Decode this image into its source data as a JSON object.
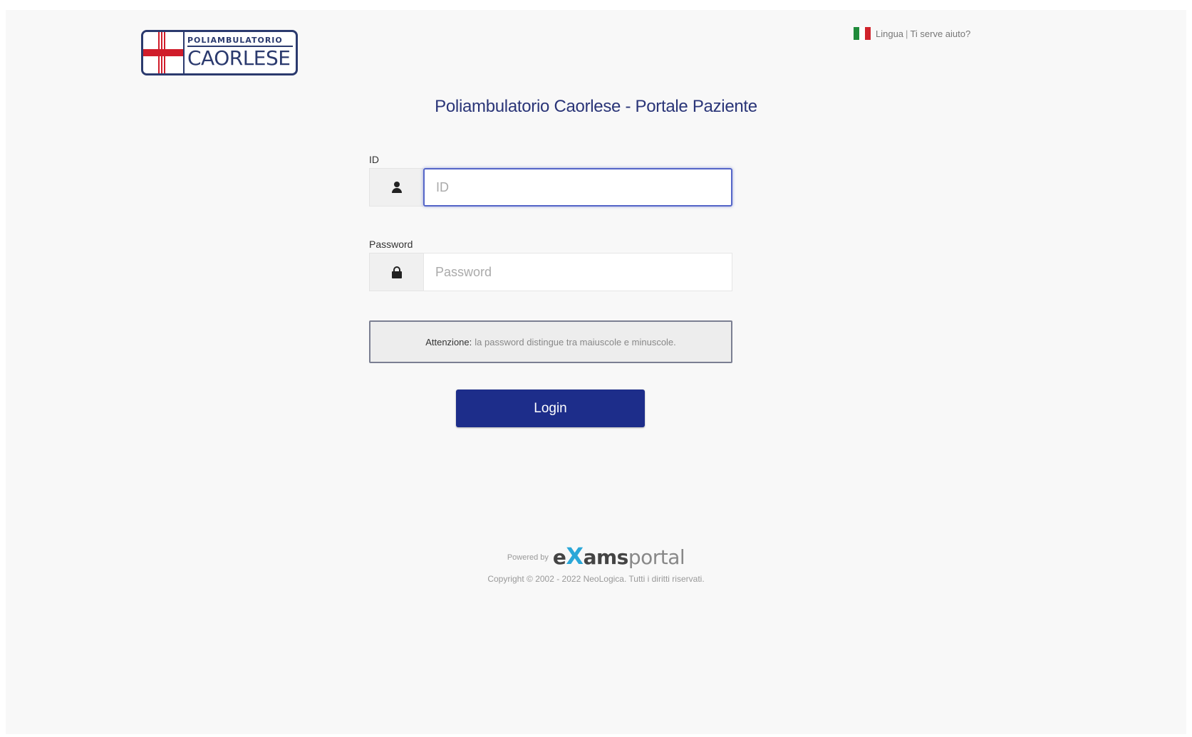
{
  "logo": {
    "top_text": "POLIAMBULATORIO",
    "bottom_text": "CAORLESE"
  },
  "topbar": {
    "language_label": "Lingua",
    "separator": "|",
    "help_label": "Ti serve aiuto?"
  },
  "title": "Poliambulatorio Caorlese - Portale Paziente",
  "form": {
    "id_label": "ID",
    "id_placeholder": "ID",
    "id_value": "",
    "password_label": "Password",
    "password_placeholder": "Password",
    "password_value": ""
  },
  "warning": {
    "prefix": "Attenzione:",
    "text": "la password distingue tra maiuscole e minuscole."
  },
  "login_label": "Login",
  "footer": {
    "powered_by": "Powered by",
    "brand_e": "e",
    "brand_x": "X",
    "brand_ams": "ams",
    "brand_portal": "portal",
    "copyright": "Copyright © 2002 - 2022 NeoLogica. Tutti i diritti riservati."
  },
  "colors": {
    "primary": "#1d2d8a",
    "title": "#2a3578",
    "logo_red": "#d01c2a",
    "brand_accent": "#2aa7d8"
  },
  "icons": {
    "id_field": "user-icon",
    "password_field": "lock-icon",
    "language": "italy-flag-icon"
  }
}
